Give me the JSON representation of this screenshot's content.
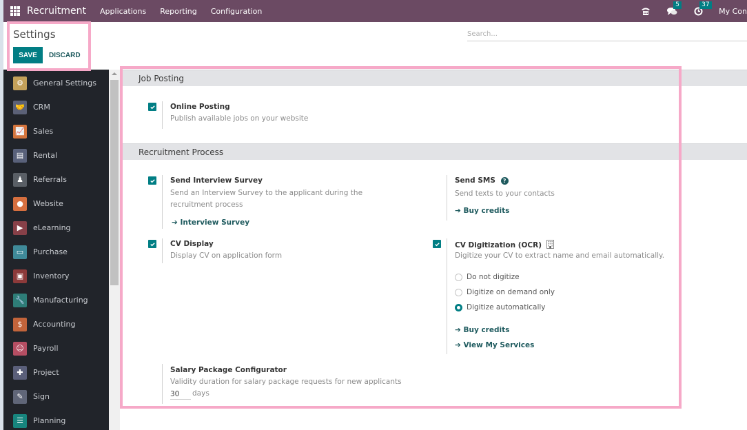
{
  "navbar": {
    "app_name": "Recruitment",
    "menu": [
      "Applications",
      "Reporting",
      "Configuration"
    ],
    "messages_count": "5",
    "activities_count": "37",
    "company": "My Con"
  },
  "control": {
    "title": "Settings",
    "save_label": "SAVE",
    "discard_label": "DISCARD",
    "search_placeholder": "Search..."
  },
  "sidebar": {
    "items": [
      {
        "label": "General Settings",
        "icon": "gear-icon",
        "color": "#c4a15a",
        "glyph": "⚙"
      },
      {
        "label": "CRM",
        "icon": "handshake-icon",
        "color": "#5b6177",
        "glyph": "🤝"
      },
      {
        "label": "Sales",
        "icon": "chart-icon",
        "color": "#d5753d",
        "glyph": "📈"
      },
      {
        "label": "Rental",
        "icon": "calendar-icon",
        "color": "#59617a",
        "glyph": "▤"
      },
      {
        "label": "Referrals",
        "icon": "person-icon",
        "color": "#5a5f66",
        "glyph": "♟"
      },
      {
        "label": "Website",
        "icon": "globe-icon",
        "color": "#d66f3f",
        "glyph": "●"
      },
      {
        "label": "eLearning",
        "icon": "elearning-icon",
        "color": "#874048",
        "glyph": "▶"
      },
      {
        "label": "Purchase",
        "icon": "purchase-icon",
        "color": "#3f8a99",
        "glyph": "▭"
      },
      {
        "label": "Inventory",
        "icon": "box-icon",
        "color": "#8c3a3a",
        "glyph": "▣"
      },
      {
        "label": "Manufacturing",
        "icon": "wrench-icon",
        "color": "#2e7d78",
        "glyph": "🔧"
      },
      {
        "label": "Accounting",
        "icon": "invoice-icon",
        "color": "#c2643b",
        "glyph": "$"
      },
      {
        "label": "Payroll",
        "icon": "payroll-icon",
        "color": "#b54e63",
        "glyph": "☺"
      },
      {
        "label": "Project",
        "icon": "puzzle-icon",
        "color": "#5a5f7a",
        "glyph": "✚"
      },
      {
        "label": "Sign",
        "icon": "sign-icon",
        "color": "#606678",
        "glyph": "✎"
      },
      {
        "label": "Planning",
        "icon": "planning-icon",
        "color": "#17857e",
        "glyph": "☰"
      }
    ]
  },
  "sections": {
    "job_posting": {
      "title": "Job Posting",
      "online_posting": {
        "checked": true,
        "title": "Online Posting",
        "desc": "Publish available jobs on your website"
      }
    },
    "recruitment_process": {
      "title": "Recruitment Process",
      "interview_survey": {
        "checked": true,
        "title": "Send Interview Survey",
        "desc": "Send an Interview Survey to the applicant during the recruitment process",
        "link": "Interview Survey"
      },
      "send_sms": {
        "title": "Send SMS",
        "desc": "Send texts to your contacts",
        "link": "Buy credits"
      },
      "cv_display": {
        "checked": true,
        "title": "CV Display",
        "desc": "Display CV on application form"
      },
      "cv_digitization": {
        "checked": true,
        "title": "CV Digitization (OCR)",
        "desc": "Digitize your CV to extract name and email automatically.",
        "options": [
          "Do not digitize",
          "Digitize on demand only",
          "Digitize automatically"
        ],
        "selected": "Digitize automatically",
        "link_credits": "Buy credits",
        "link_services": "View My Services"
      },
      "salary_package": {
        "title": "Salary Package Configurator",
        "desc": "Validity duration for salary package requests for new applicants",
        "value": "30",
        "unit": "days"
      }
    }
  }
}
